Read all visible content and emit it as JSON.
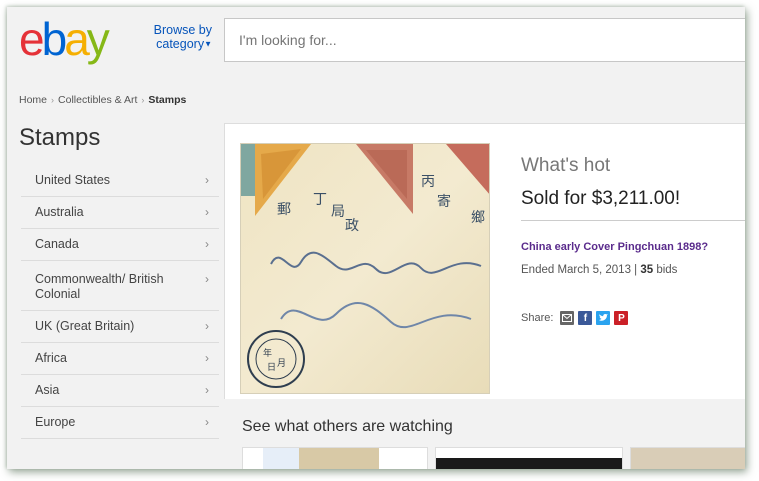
{
  "header": {
    "logo": [
      "e",
      "b",
      "a",
      "y"
    ],
    "logo_colors": [
      "#e53238",
      "#0064d2",
      "#f5af02",
      "#86b817"
    ],
    "browse_line1": "Browse by",
    "browse_line2": "category",
    "search_placeholder": "I'm looking for..."
  },
  "breadcrumb": {
    "items": [
      "Home",
      "Collectibles & Art"
    ],
    "current": "Stamps"
  },
  "sidebar": {
    "title": "Stamps",
    "items": [
      {
        "label": "United States"
      },
      {
        "label": "Australia"
      },
      {
        "label": "Canada"
      },
      {
        "label": "Commonwealth/ British Colonial"
      },
      {
        "label": "UK (Great Britain)"
      },
      {
        "label": "Africa"
      },
      {
        "label": "Asia"
      },
      {
        "label": "Europe"
      }
    ]
  },
  "hot": {
    "label": "What's hot",
    "sold": "Sold for $3,211.00!",
    "item_title": "China early Cover Pingchuan 1898?",
    "ended_prefix": "Ended March 5, 2013 | ",
    "bids_count": "35",
    "bids_suffix": " bids",
    "share_label": "Share:",
    "share_icons": [
      "email-icon",
      "facebook-icon",
      "twitter-icon",
      "pinterest-icon"
    ],
    "share_colors": [
      "#666666",
      "#3b5998",
      "#2aa3ef",
      "#cb2027"
    ]
  },
  "watching": {
    "title": "See what others are watching"
  }
}
